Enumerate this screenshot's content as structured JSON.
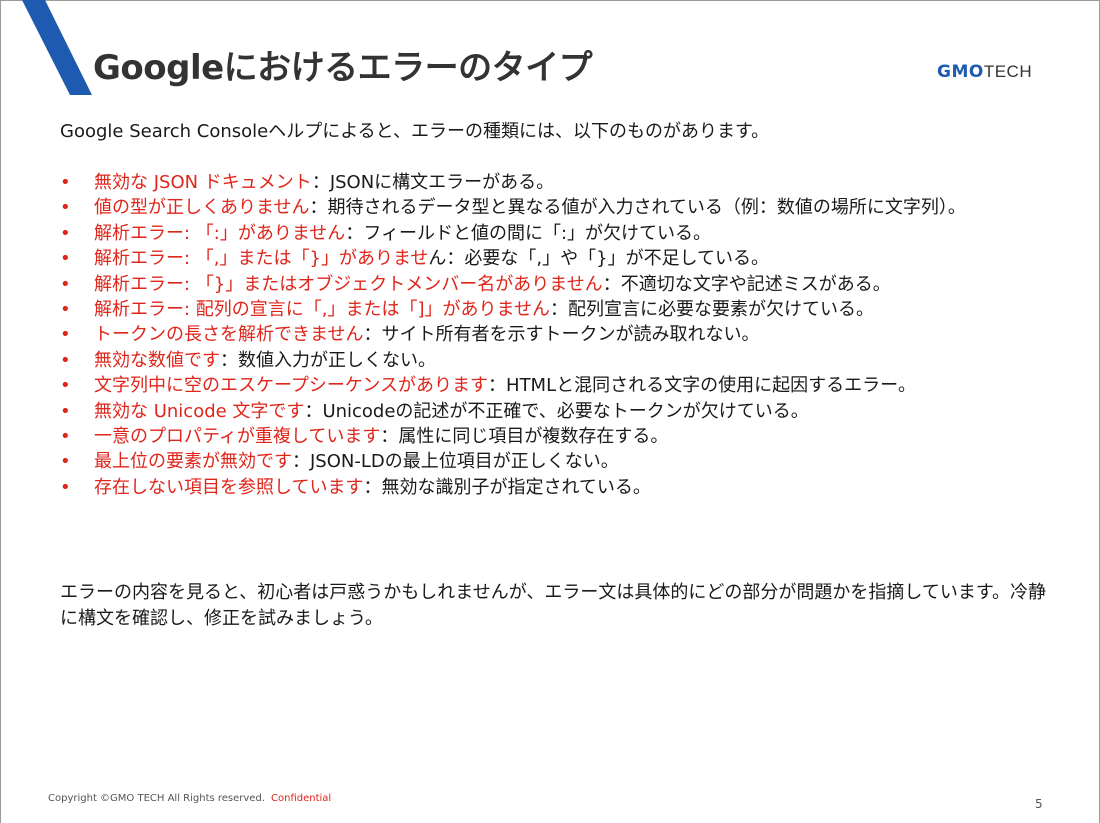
{
  "slide": {
    "title": "Googleにおけるエラーのタイプ",
    "logo": {
      "gmo": "GMO",
      "tech": "TECH"
    },
    "accent_color": "#1e5bb0",
    "highlight_color": "#e0251b"
  },
  "content": {
    "intro": "Google Search Consoleヘルプによると、エラーの種類には、以下のものがあります。",
    "bullet_glyph": "•",
    "separator": "：",
    "errors": [
      {
        "name": "無効な JSON ドキュメント",
        "desc": "JSONに構文エラーがある。"
      },
      {
        "name": "値の型が正しくありません",
        "desc": "期待されるデータ型と異なる値が入力されている（例：数値の場所に文字列）。"
      },
      {
        "name": "解析エラー: 「:」がありません",
        "desc": "フィールドと値の間に「:」が欠けている。"
      },
      {
        "name": "解析エラー: 「,」または「}」がありませ",
        "desc": "ん：必要な「,」や「}」が不足している。"
      },
      {
        "name": "解析エラー: 「}」またはオブジェクトメンバー名がありません",
        "desc": "不適切な文字や記述ミスがある。"
      },
      {
        "name": "解析エラー: 配列の宣言に「,」または「]」がありません",
        "desc": "配列宣言に必要な要素が欠けている。"
      },
      {
        "name": "トークンの長さを解析できません",
        "desc": "サイト所有者を示すトークンが読み取れない。"
      },
      {
        "name": "無効な数値です",
        "desc": "数値入力が正しくない。"
      },
      {
        "name": "文字列中に空のエスケープシーケンスがあります",
        "desc": "HTMLと混同される文字の使用に起因するエラー。"
      },
      {
        "name": "無効な Unicode 文字です",
        "desc": "Unicodeの記述が不正確で、必要なトークンが欠けている。"
      },
      {
        "name": "一意のプロパティが重複しています",
        "desc": "属性に同じ項目が複数存在する。"
      },
      {
        "name": "最上位の要素が無効です",
        "desc": "JSON-LDの最上位項目が正しくない。"
      },
      {
        "name": "存在しない項目を参照しています",
        "desc": "無効な識別子が指定されている。"
      }
    ],
    "outro": "エラーの内容を見ると、初心者は戸惑うかもしれませんが、エラー文は具体的にどの部分が問題かを指摘しています。冷静に構文を確認し、修正を試みましょう。"
  },
  "footer": {
    "copyright": "Copyright ©GMO TECH All Rights reserved.",
    "confidential": "Confidential",
    "page_number": "5"
  }
}
